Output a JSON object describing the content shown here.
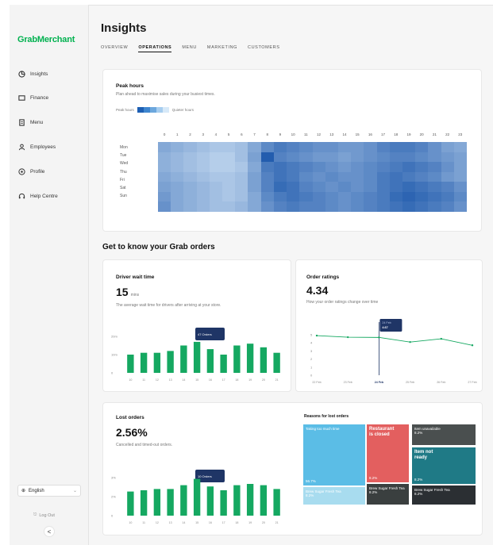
{
  "app": {
    "brand": "GrabMerchant",
    "page_title": "Insights"
  },
  "sidebar": {
    "items": [
      {
        "label": "Insights",
        "icon": "insights-icon"
      },
      {
        "label": "Finance",
        "icon": "finance-icon"
      },
      {
        "label": "Menu",
        "icon": "menu-icon"
      },
      {
        "label": "Employees",
        "icon": "employees-icon"
      },
      {
        "label": "Profile",
        "icon": "profile-icon"
      },
      {
        "label": "Help Centre",
        "icon": "help-icon"
      }
    ],
    "language": "English",
    "logout": "Log Out",
    "collapse": "<"
  },
  "tabs": [
    {
      "label": "OVERVIEW",
      "active": false
    },
    {
      "label": "OPERATIONS",
      "active": true
    },
    {
      "label": "MENU",
      "active": false
    },
    {
      "label": "MARKETING",
      "active": false
    },
    {
      "label": "CUSTOMERS",
      "active": false
    }
  ],
  "peak_hours": {
    "title": "Peak hours",
    "subtitle": "Plan ahead to maximise sales during your busiest times.",
    "legend_left": "Peak hours",
    "legend_right": "Quieter hours",
    "legend_colors": [
      "#1d5fb3",
      "#3f86cf",
      "#6ca7dd",
      "#a6cdef",
      "#d7e9f8"
    ],
    "hours": [
      "0",
      "1",
      "2",
      "3",
      "4",
      "5",
      "6",
      "7",
      "8",
      "9",
      "10",
      "11",
      "12",
      "13",
      "14",
      "15",
      "16",
      "17",
      "18",
      "19",
      "20",
      "21",
      "22",
      "23"
    ],
    "days": [
      "Mon",
      "Tue",
      "Wed",
      "Thu",
      "Fri",
      "Sat",
      "Sun"
    ]
  },
  "orders_section": {
    "title": "Get to know your Grab orders"
  },
  "driver_wait": {
    "title": "Driver wait time",
    "value": "15",
    "unit": "mins",
    "subtitle": "The average wait time for drivers after arriving at your store.",
    "tooltip": "47 Orders",
    "y_ticks": [
      "20m",
      "10m",
      "0"
    ]
  },
  "order_ratings": {
    "title": "Order ratings",
    "value": "4.34",
    "subtitle": "How your order ratings change over time",
    "tooltip_line1": "24 Feb",
    "tooltip_line2": "4.67",
    "y_ticks": [
      "5",
      "4",
      "3",
      "2",
      "1",
      "0"
    ],
    "x_labels": [
      "22 Feb",
      "23 Feb",
      "24 Feb",
      "25 Feb",
      "26 Feb",
      "27 Feb"
    ]
  },
  "lost_orders": {
    "title": "Lost orders",
    "value": "2.56%",
    "subtitle": "Cancelled and timed-out orders.",
    "tooltip": "10 Orders",
    "y_ticks": [
      "3%",
      "2%",
      "0"
    ]
  },
  "reasons": {
    "title": "Reasons for lost orders",
    "items": [
      {
        "label": "Taking too much time",
        "value": "56.7%",
        "color": "#5bbde6"
      },
      {
        "label": "Restaurant is closed",
        "value": "8.2%",
        "color": "#e35f5f"
      },
      {
        "label": "Item unavailable",
        "value": "8.2%",
        "color": "#4a4f4f"
      },
      {
        "label": "Item not ready",
        "value": "8.2%",
        "color": "#1f7a86"
      },
      {
        "label": "Brew Sugar Fresh Tea",
        "value": "8.2%",
        "color": "#a8dcef"
      },
      {
        "label": "Brew Sugar Fresh Tea",
        "value": "8.2%",
        "color": "#3a3f3f"
      },
      {
        "label": "Brew Sugar Fresh Tea",
        "value": "8.2%",
        "color": "#2b2f33"
      }
    ]
  },
  "chart_data": [
    {
      "type": "heatmap",
      "title": "Peak hours",
      "x": [
        "0",
        "1",
        "2",
        "3",
        "4",
        "5",
        "6",
        "7",
        "8",
        "9",
        "10",
        "11",
        "12",
        "13",
        "14",
        "15",
        "16",
        "17",
        "18",
        "19",
        "20",
        "21",
        "22",
        "23"
      ],
      "y": [
        "Mon",
        "Tue",
        "Wed",
        "Thu",
        "Fri",
        "Sat",
        "Sun"
      ],
      "values": [
        [
          0.45,
          0.4,
          0.35,
          0.3,
          0.25,
          0.25,
          0.3,
          0.45,
          0.65,
          0.75,
          0.7,
          0.65,
          0.6,
          0.6,
          0.55,
          0.55,
          0.6,
          0.7,
          0.75,
          0.75,
          0.7,
          0.6,
          0.5,
          0.45
        ],
        [
          0.4,
          0.35,
          0.3,
          0.25,
          0.2,
          0.2,
          0.3,
          0.5,
          0.95,
          0.7,
          0.65,
          0.6,
          0.55,
          0.55,
          0.5,
          0.55,
          0.6,
          0.65,
          0.7,
          0.7,
          0.65,
          0.6,
          0.55,
          0.5
        ],
        [
          0.4,
          0.35,
          0.3,
          0.25,
          0.2,
          0.2,
          0.25,
          0.45,
          0.75,
          0.8,
          0.75,
          0.7,
          0.65,
          0.6,
          0.55,
          0.6,
          0.65,
          0.7,
          0.75,
          0.8,
          0.75,
          0.7,
          0.6,
          0.5
        ],
        [
          0.45,
          0.4,
          0.35,
          0.3,
          0.25,
          0.25,
          0.3,
          0.5,
          0.7,
          0.8,
          0.75,
          0.65,
          0.6,
          0.65,
          0.6,
          0.6,
          0.65,
          0.75,
          0.8,
          0.75,
          0.7,
          0.65,
          0.55,
          0.5
        ],
        [
          0.5,
          0.45,
          0.4,
          0.35,
          0.3,
          0.25,
          0.3,
          0.5,
          0.7,
          0.85,
          0.8,
          0.7,
          0.65,
          0.6,
          0.65,
          0.6,
          0.65,
          0.75,
          0.8,
          0.85,
          0.8,
          0.75,
          0.7,
          0.6
        ],
        [
          0.55,
          0.45,
          0.4,
          0.35,
          0.3,
          0.25,
          0.3,
          0.45,
          0.65,
          0.75,
          0.8,
          0.75,
          0.7,
          0.65,
          0.6,
          0.65,
          0.7,
          0.75,
          0.85,
          0.9,
          0.85,
          0.8,
          0.75,
          0.65
        ],
        [
          0.6,
          0.45,
          0.4,
          0.35,
          0.3,
          0.3,
          0.35,
          0.45,
          0.6,
          0.7,
          0.75,
          0.7,
          0.7,
          0.65,
          0.6,
          0.65,
          0.7,
          0.75,
          0.8,
          0.85,
          0.8,
          0.75,
          0.7,
          0.6
        ]
      ]
    },
    {
      "type": "bar",
      "title": "Driver wait time",
      "categories": [
        "10",
        "11",
        "12",
        "13",
        "14",
        "15",
        "16",
        "17",
        "18",
        "19",
        "20",
        "21"
      ],
      "values": [
        10,
        11,
        11,
        12,
        15,
        17,
        13,
        10,
        15,
        16,
        14,
        11
      ],
      "ylim": [
        0,
        20
      ]
    },
    {
      "type": "line",
      "title": "Order ratings",
      "x": [
        "22 Feb",
        "23 Feb",
        "24 Feb",
        "25 Feb",
        "26 Feb",
        "27 Feb"
      ],
      "values": [
        4.9,
        4.7,
        4.67,
        4.1,
        4.5,
        3.7
      ],
      "ylim": [
        0,
        5
      ]
    },
    {
      "type": "bar",
      "title": "Lost orders",
      "categories": [
        "10",
        "11",
        "12",
        "13",
        "14",
        "15",
        "16",
        "17",
        "18",
        "19",
        "20",
        "21"
      ],
      "values": [
        1.9,
        2.0,
        2.1,
        2.1,
        2.4,
        2.9,
        2.3,
        2.0,
        2.4,
        2.5,
        2.4,
        2.1
      ],
      "ylim": [
        0,
        3
      ]
    }
  ]
}
